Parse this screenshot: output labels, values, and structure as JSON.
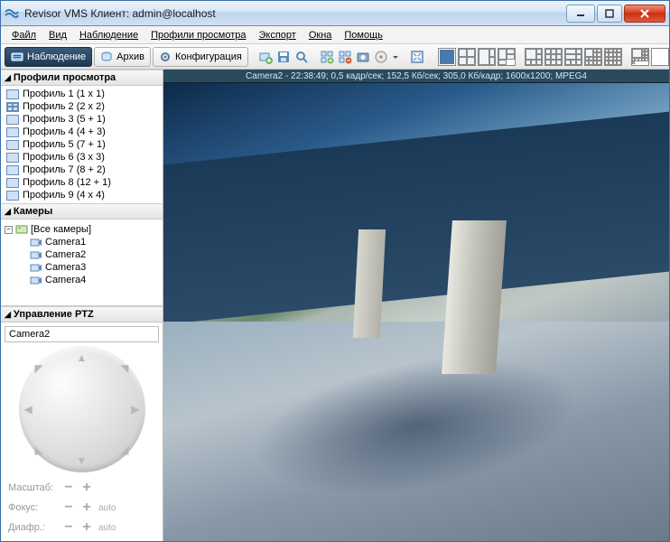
{
  "window": {
    "title": "Revisor VMS Клиент: admin@localhost"
  },
  "menu": {
    "file": "Файл",
    "view": "Вид",
    "surveillance": "Наблюдение",
    "profiles": "Профили просмотра",
    "export": "Экспорт",
    "windows": "Окна",
    "help": "Помощь"
  },
  "toolbar": {
    "surveillance": "Наблюдение",
    "archive": "Архив",
    "config": "Конфигурация"
  },
  "sidebar": {
    "profiles_header": "Профили просмотра",
    "profiles": [
      {
        "label": "Профиль 1 (1 x 1)"
      },
      {
        "label": "Профиль 2 (2 x 2)"
      },
      {
        "label": "Профиль 3 (5 + 1)"
      },
      {
        "label": "Профиль 4 (4 + 3)"
      },
      {
        "label": "Профиль 5 (7 + 1)"
      },
      {
        "label": "Профиль 6 (3 x 3)"
      },
      {
        "label": "Профиль 7 (8 + 2)"
      },
      {
        "label": "Профиль 8 (12 + 1)"
      },
      {
        "label": "Профиль 9 (4 x 4)"
      }
    ],
    "cameras_header": "Камеры",
    "cameras_root": "[Все камеры]",
    "cameras": [
      {
        "label": "Camera1"
      },
      {
        "label": "Camera2"
      },
      {
        "label": "Camera3"
      },
      {
        "label": "Camera4"
      }
    ],
    "ptz_header": "Управление PTZ",
    "ptz_camera": "Camera2",
    "ptz": {
      "zoom": "Масштаб:",
      "focus": "Фокус:",
      "iris": "Диафр.:",
      "auto": "auto"
    }
  },
  "camera_status": "Camera2 - 22:38:49; 0,5 кадр/сек; 152,5 Кб/сек; 305,0 Кб/кадр; 1600x1200; MPEG4"
}
